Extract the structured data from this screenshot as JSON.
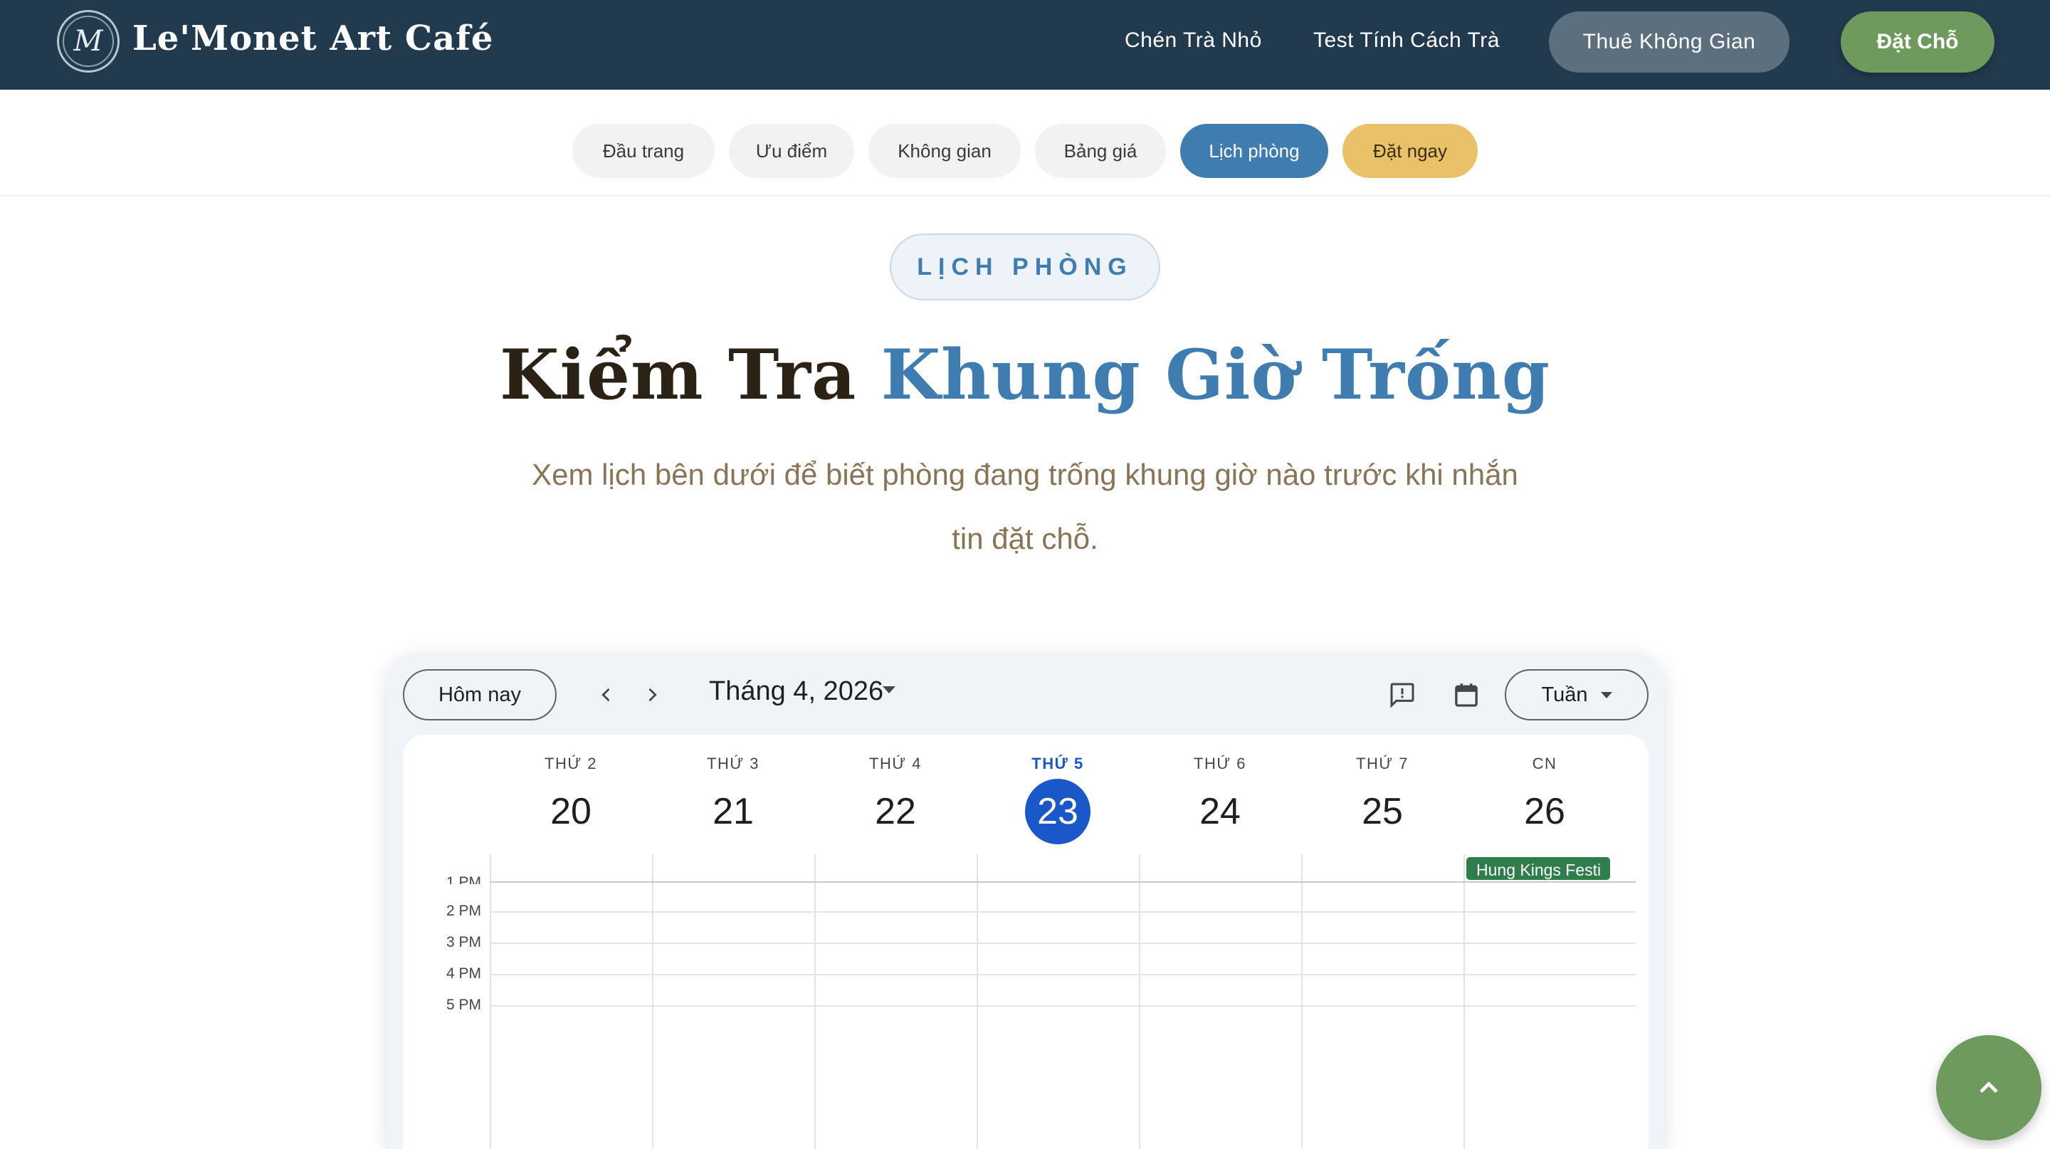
{
  "header": {
    "logo_letter": "M",
    "brand": "Le'Monet Art Café",
    "links": [
      "Chén Trà Nhỏ",
      "Test Tính Cách Trà"
    ],
    "hire_button": "Thuê Không Gian",
    "book_button": "Đặt Chỗ"
  },
  "section_nav": {
    "items": [
      "Đầu trang",
      "Ưu điểm",
      "Không gian",
      "Bảng giá",
      "Lịch phòng",
      "Đặt ngay"
    ],
    "active": "Lịch phòng"
  },
  "hero": {
    "badge": "LỊCH PHÒNG",
    "title_dark": "Kiểm Tra",
    "title_blue": "Khung Giờ Trống",
    "subtitle": "Xem lịch bên dưới để biết phòng đang trống khung giờ nào trước khi nhắn tin đặt chỗ."
  },
  "calendar": {
    "today_button": "Hôm nay",
    "prev_icon": "chevron-left-icon",
    "next_icon": "chevron-right-icon",
    "month": "Tháng 4, 2026",
    "view": "Tuần",
    "days": [
      {
        "name": "THỨ 2",
        "num": "20"
      },
      {
        "name": "THỨ 3",
        "num": "21"
      },
      {
        "name": "THỨ 4",
        "num": "22"
      },
      {
        "name": "THỨ 5",
        "num": "23"
      },
      {
        "name": "THỨ 6",
        "num": "24"
      },
      {
        "name": "THỨ 7",
        "num": "25"
      },
      {
        "name": "CN",
        "num": "26"
      }
    ],
    "today_index": 3,
    "times": [
      "1 PM",
      "2 PM",
      "3 PM",
      "4 PM",
      "5 PM"
    ],
    "event": "Hung Kings Festi",
    "colors": {
      "today": "#1a57c9",
      "event": "#2e7d4a"
    }
  },
  "colors": {
    "header_bg": "#223a4e",
    "accent_blue": "#3f7db0",
    "accent_green": "#6f9a5e",
    "accent_gold": "#e8c168"
  }
}
